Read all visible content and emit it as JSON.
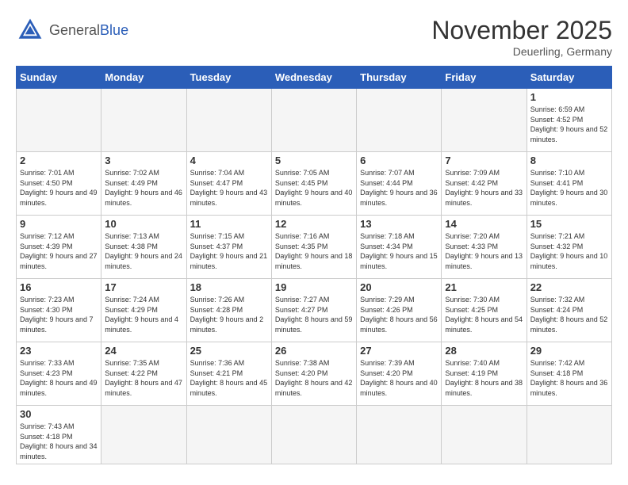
{
  "header": {
    "logo_general": "General",
    "logo_blue": "Blue",
    "month_title": "November 2025",
    "location": "Deuerling, Germany"
  },
  "weekdays": [
    "Sunday",
    "Monday",
    "Tuesday",
    "Wednesday",
    "Thursday",
    "Friday",
    "Saturday"
  ],
  "weeks": [
    [
      {
        "day": "",
        "info": ""
      },
      {
        "day": "",
        "info": ""
      },
      {
        "day": "",
        "info": ""
      },
      {
        "day": "",
        "info": ""
      },
      {
        "day": "",
        "info": ""
      },
      {
        "day": "",
        "info": ""
      },
      {
        "day": "1",
        "info": "Sunrise: 6:59 AM\nSunset: 4:52 PM\nDaylight: 9 hours and 52 minutes."
      }
    ],
    [
      {
        "day": "2",
        "info": "Sunrise: 7:01 AM\nSunset: 4:50 PM\nDaylight: 9 hours and 49 minutes."
      },
      {
        "day": "3",
        "info": "Sunrise: 7:02 AM\nSunset: 4:49 PM\nDaylight: 9 hours and 46 minutes."
      },
      {
        "day": "4",
        "info": "Sunrise: 7:04 AM\nSunset: 4:47 PM\nDaylight: 9 hours and 43 minutes."
      },
      {
        "day": "5",
        "info": "Sunrise: 7:05 AM\nSunset: 4:45 PM\nDaylight: 9 hours and 40 minutes."
      },
      {
        "day": "6",
        "info": "Sunrise: 7:07 AM\nSunset: 4:44 PM\nDaylight: 9 hours and 36 minutes."
      },
      {
        "day": "7",
        "info": "Sunrise: 7:09 AM\nSunset: 4:42 PM\nDaylight: 9 hours and 33 minutes."
      },
      {
        "day": "8",
        "info": "Sunrise: 7:10 AM\nSunset: 4:41 PM\nDaylight: 9 hours and 30 minutes."
      }
    ],
    [
      {
        "day": "9",
        "info": "Sunrise: 7:12 AM\nSunset: 4:39 PM\nDaylight: 9 hours and 27 minutes."
      },
      {
        "day": "10",
        "info": "Sunrise: 7:13 AM\nSunset: 4:38 PM\nDaylight: 9 hours and 24 minutes."
      },
      {
        "day": "11",
        "info": "Sunrise: 7:15 AM\nSunset: 4:37 PM\nDaylight: 9 hours and 21 minutes."
      },
      {
        "day": "12",
        "info": "Sunrise: 7:16 AM\nSunset: 4:35 PM\nDaylight: 9 hours and 18 minutes."
      },
      {
        "day": "13",
        "info": "Sunrise: 7:18 AM\nSunset: 4:34 PM\nDaylight: 9 hours and 15 minutes."
      },
      {
        "day": "14",
        "info": "Sunrise: 7:20 AM\nSunset: 4:33 PM\nDaylight: 9 hours and 13 minutes."
      },
      {
        "day": "15",
        "info": "Sunrise: 7:21 AM\nSunset: 4:32 PM\nDaylight: 9 hours and 10 minutes."
      }
    ],
    [
      {
        "day": "16",
        "info": "Sunrise: 7:23 AM\nSunset: 4:30 PM\nDaylight: 9 hours and 7 minutes."
      },
      {
        "day": "17",
        "info": "Sunrise: 7:24 AM\nSunset: 4:29 PM\nDaylight: 9 hours and 4 minutes."
      },
      {
        "day": "18",
        "info": "Sunrise: 7:26 AM\nSunset: 4:28 PM\nDaylight: 9 hours and 2 minutes."
      },
      {
        "day": "19",
        "info": "Sunrise: 7:27 AM\nSunset: 4:27 PM\nDaylight: 8 hours and 59 minutes."
      },
      {
        "day": "20",
        "info": "Sunrise: 7:29 AM\nSunset: 4:26 PM\nDaylight: 8 hours and 56 minutes."
      },
      {
        "day": "21",
        "info": "Sunrise: 7:30 AM\nSunset: 4:25 PM\nDaylight: 8 hours and 54 minutes."
      },
      {
        "day": "22",
        "info": "Sunrise: 7:32 AM\nSunset: 4:24 PM\nDaylight: 8 hours and 52 minutes."
      }
    ],
    [
      {
        "day": "23",
        "info": "Sunrise: 7:33 AM\nSunset: 4:23 PM\nDaylight: 8 hours and 49 minutes."
      },
      {
        "day": "24",
        "info": "Sunrise: 7:35 AM\nSunset: 4:22 PM\nDaylight: 8 hours and 47 minutes."
      },
      {
        "day": "25",
        "info": "Sunrise: 7:36 AM\nSunset: 4:21 PM\nDaylight: 8 hours and 45 minutes."
      },
      {
        "day": "26",
        "info": "Sunrise: 7:38 AM\nSunset: 4:20 PM\nDaylight: 8 hours and 42 minutes."
      },
      {
        "day": "27",
        "info": "Sunrise: 7:39 AM\nSunset: 4:20 PM\nDaylight: 8 hours and 40 minutes."
      },
      {
        "day": "28",
        "info": "Sunrise: 7:40 AM\nSunset: 4:19 PM\nDaylight: 8 hours and 38 minutes."
      },
      {
        "day": "29",
        "info": "Sunrise: 7:42 AM\nSunset: 4:18 PM\nDaylight: 8 hours and 36 minutes."
      }
    ],
    [
      {
        "day": "30",
        "info": "Sunrise: 7:43 AM\nSunset: 4:18 PM\nDaylight: 8 hours and 34 minutes."
      },
      {
        "day": "",
        "info": ""
      },
      {
        "day": "",
        "info": ""
      },
      {
        "day": "",
        "info": ""
      },
      {
        "day": "",
        "info": ""
      },
      {
        "day": "",
        "info": ""
      },
      {
        "day": "",
        "info": ""
      }
    ]
  ]
}
